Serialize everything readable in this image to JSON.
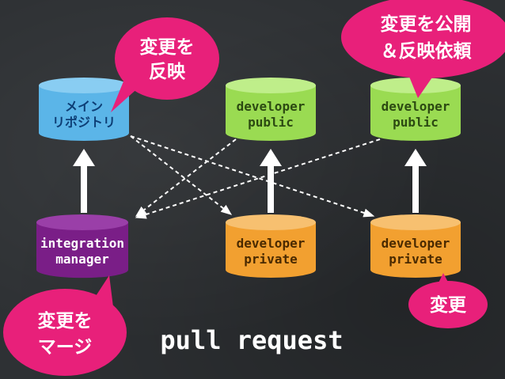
{
  "repositories": {
    "main_repo": {
      "lines": [
        "メイン",
        "リポジトリ"
      ],
      "color": "#5bb5e8"
    },
    "public_1": {
      "lines": [
        "developer",
        "public"
      ],
      "color": "#9adb52"
    },
    "public_2": {
      "lines": [
        "developer",
        "public"
      ],
      "color": "#9adb52"
    },
    "integration_manager": {
      "lines": [
        "integration",
        "manager"
      ],
      "color": "#7a1e87"
    },
    "private_1": {
      "lines": [
        "developer",
        "private"
      ],
      "color": "#f2a030"
    },
    "private_2": {
      "lines": [
        "developer",
        "private"
      ],
      "color": "#f2a030"
    }
  },
  "bubbles": {
    "reflect": {
      "lines": [
        "変更を",
        "反映"
      ]
    },
    "publish": {
      "lines": [
        "変更を公開",
        "＆反映依頼"
      ]
    },
    "merge": {
      "lines": [
        "変更を",
        "マージ"
      ]
    },
    "change": {
      "lines": [
        "変更"
      ]
    }
  },
  "bubble_color": "#e8207a",
  "caption": "pull request"
}
